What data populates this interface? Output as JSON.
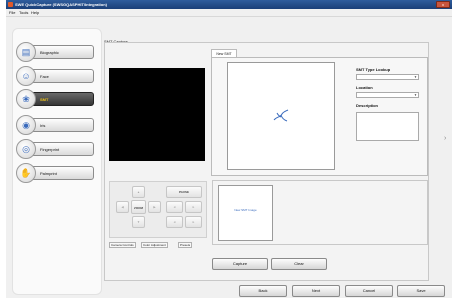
{
  "window": {
    "title": "SWE QuickCapture (SWSGQASPHIT/Integration)",
    "close_label": "x"
  },
  "menu": [
    "File",
    "Tools",
    "Help"
  ],
  "nav": [
    {
      "label": "Biographic",
      "icon": "document-icon",
      "active": false
    },
    {
      "label": "Face",
      "icon": "face-icon",
      "active": false
    },
    {
      "label": "SMT",
      "icon": "tattoo-icon",
      "active": true
    },
    {
      "label": "Iris",
      "icon": "eye-icon",
      "active": false
    },
    {
      "label": "Fingerprint",
      "icon": "fingerprint-icon",
      "active": false
    },
    {
      "label": "Palmprint",
      "icon": "palm-icon",
      "active": false
    }
  ],
  "capture_group_label": "SMT Capture",
  "camera": {
    "pause_label": "PAUSE",
    "zoom_label": "ZOOM",
    "tabs": [
      "Camera Controls",
      "Color Adjustment",
      "Presets"
    ]
  },
  "smt_tab": {
    "tab_label": "New SMT",
    "type_lookup_label": "SMT Type Lookup",
    "location_label": "Location",
    "description_label": "Description",
    "type_lookup_value": "",
    "location_value": "",
    "description_value": ""
  },
  "thumbnail_label": "New SMT Image",
  "capture_buttons": {
    "capture": "Capture",
    "clear": "Clear"
  },
  "footer": {
    "back": "Back",
    "next": "Next",
    "cancel": "Cancel",
    "save": "Save"
  }
}
